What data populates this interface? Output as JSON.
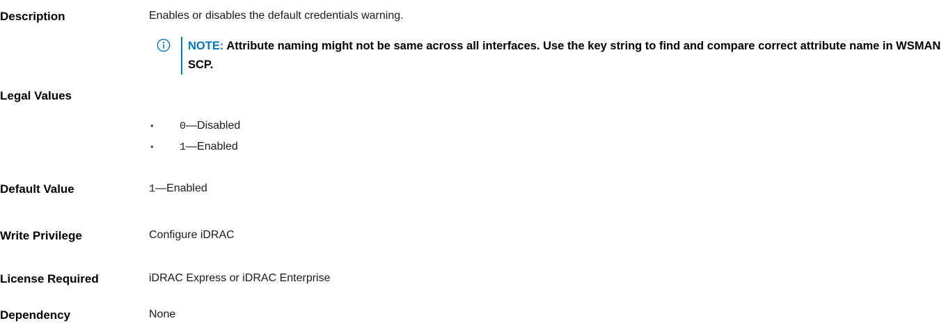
{
  "description": {
    "label": "Description",
    "value": "Enables or disables the default credentials warning."
  },
  "note": {
    "icon": "info-circle-icon",
    "prefix": "NOTE:",
    "text": " Attribute naming might not be same across all interfaces. Use the key string to find and compare correct attribute name in WSMAN SCP.",
    "accent_color": "#0076ce"
  },
  "legal_values": {
    "label": "Legal Values",
    "items": [
      {
        "code": "0",
        "sep": "—",
        "text": "Disabled"
      },
      {
        "code": "1",
        "sep": "—",
        "text": "Enabled"
      }
    ]
  },
  "default_value": {
    "label": "Default Value",
    "code": "1",
    "sep": "—",
    "text": "Enabled"
  },
  "write_privilege": {
    "label": "Write Privilege",
    "value": "Configure iDRAC"
  },
  "license_required": {
    "label": "License Required",
    "value": "iDRAC Express or iDRAC Enterprise"
  },
  "dependency": {
    "label": "Dependency",
    "value": "None"
  }
}
